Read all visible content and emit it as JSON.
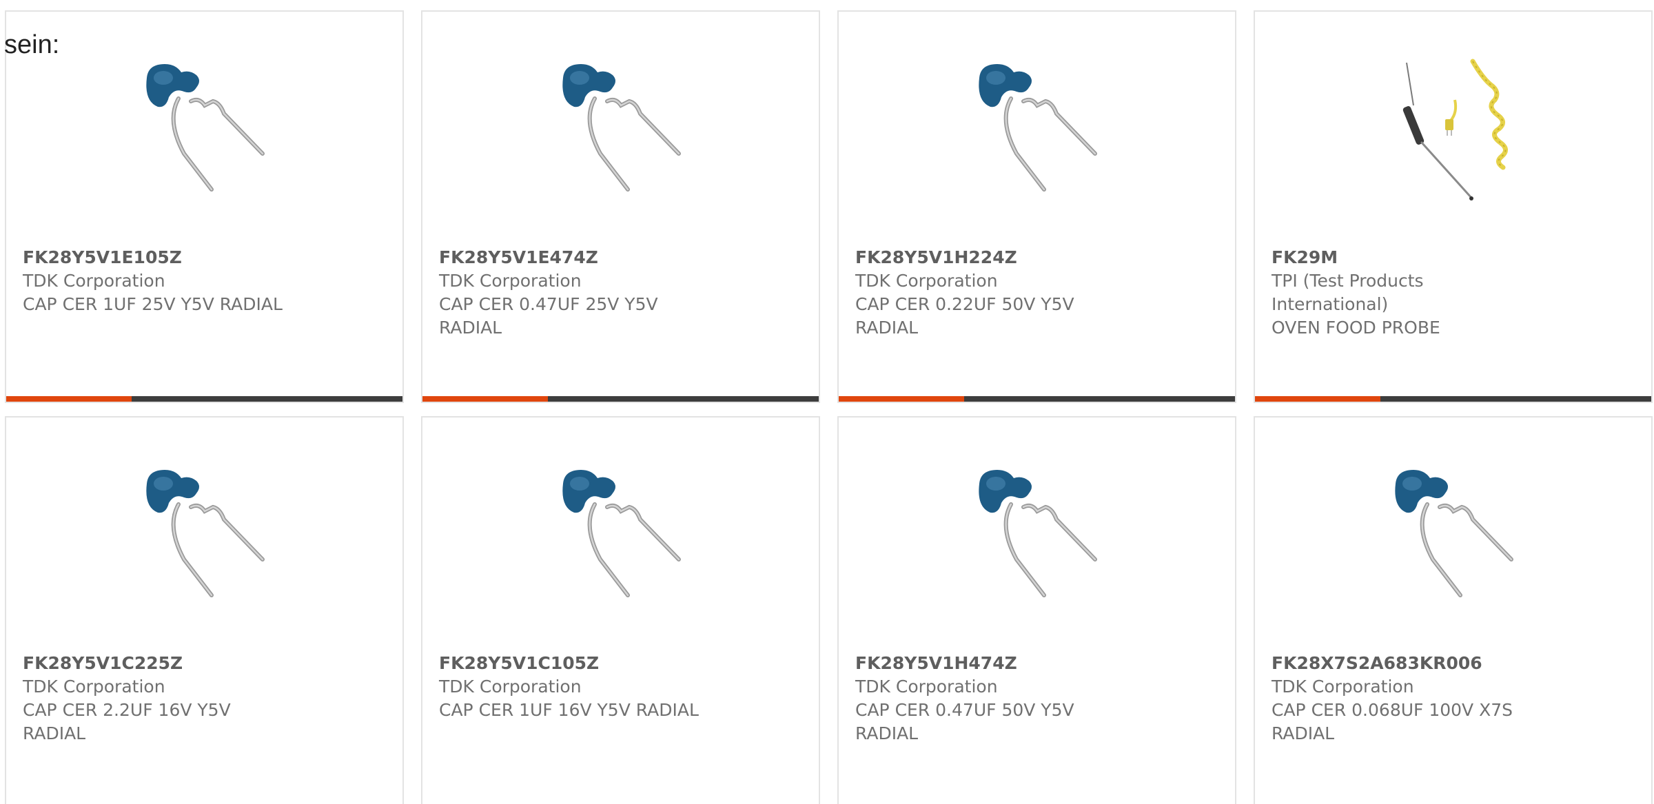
{
  "intro": {
    "text": "sein:"
  },
  "products": [
    {
      "part_number": "FK28Y5V1E105Z",
      "manufacturer": "TDK Corporation",
      "description": "CAP CER 1UF 25V Y5V RADIAL",
      "image": "ceramic-capacitor-image"
    },
    {
      "part_number": "FK28Y5V1E474Z",
      "manufacturer": "TDK Corporation",
      "description": "CAP CER 0.47UF 25V Y5V RADIAL",
      "image": "ceramic-capacitor-image"
    },
    {
      "part_number": "FK28Y5V1H224Z",
      "manufacturer": "TDK Corporation",
      "description": "CAP CER 0.22UF 50V Y5V RADIAL",
      "image": "ceramic-capacitor-image"
    },
    {
      "part_number": "FK29M",
      "manufacturer": "TPI (Test Products International)",
      "description": "OVEN FOOD PROBE",
      "image": "temperature-probe-image"
    },
    {
      "part_number": "FK28Y5V1C225Z",
      "manufacturer": "TDK Corporation",
      "description": "CAP CER 2.2UF 16V Y5V RADIAL",
      "image": "ceramic-capacitor-image"
    },
    {
      "part_number": "FK28Y5V1C105Z",
      "manufacturer": "TDK Corporation",
      "description": "CAP CER 1UF 16V Y5V RADIAL",
      "image": "ceramic-capacitor-image"
    },
    {
      "part_number": "FK28Y5V1H474Z",
      "manufacturer": "TDK Corporation",
      "description": "CAP CER 0.47UF 50V Y5V RADIAL",
      "image": "ceramic-capacitor-image"
    },
    {
      "part_number": "FK28X7S2A683KR006",
      "manufacturer": "TDK Corporation",
      "description": "CAP CER 0.068UF 100V X7S RADIAL",
      "image": "ceramic-capacitor-image"
    }
  ],
  "colors": {
    "accent": "#e0460d",
    "bar_track": "#3d3d3d",
    "capacitor_body": "#1e5c86",
    "probe_cable": "#e6d24a"
  }
}
